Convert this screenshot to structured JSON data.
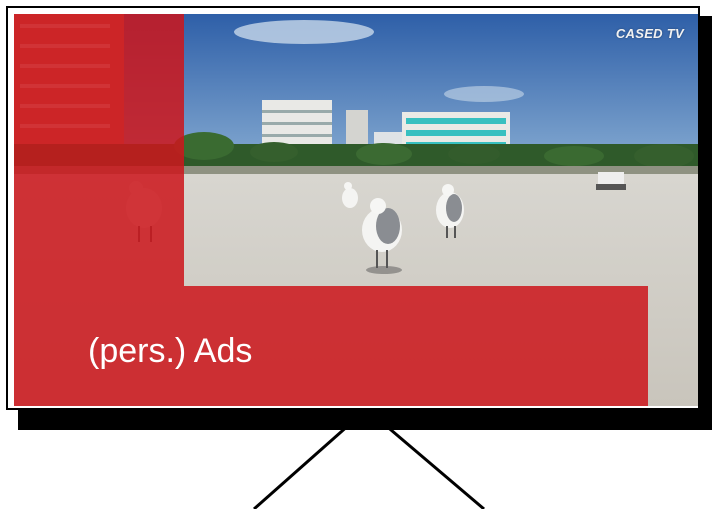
{
  "tv": {
    "brand": "CASED TV"
  },
  "overlay": {
    "label": "(pers.) Ads",
    "color": "#cc161c"
  },
  "icons": [
    "tv-stand-icon",
    "seagull-icon",
    "building-icon",
    "palm-tree-icon"
  ]
}
